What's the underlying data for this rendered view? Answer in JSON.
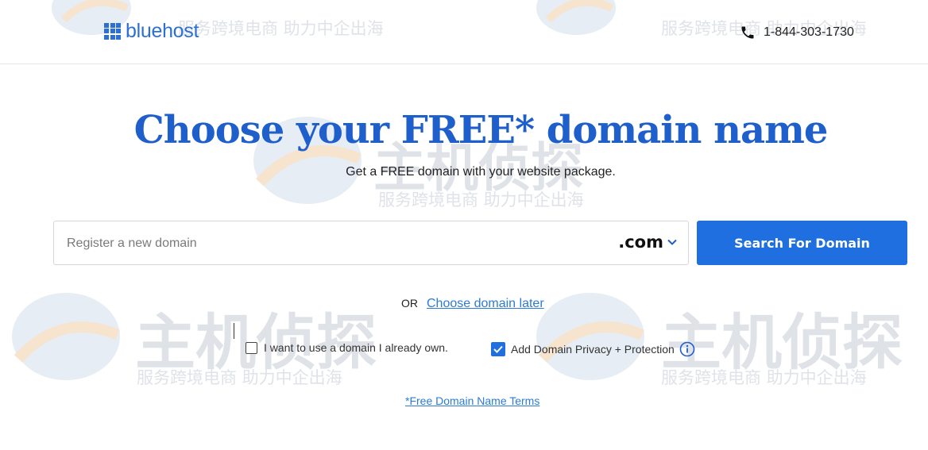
{
  "header": {
    "logo_text": "bluehost",
    "phone_icon": "phone-icon",
    "phone_number": "1-844-303-1730"
  },
  "hero": {
    "title": "Choose your FREE* domain name",
    "subtitle": "Get a FREE domain with your website package."
  },
  "search": {
    "placeholder": "Register a new domain",
    "value": "",
    "tld": ".com",
    "tld_icon": "chevron-down-icon",
    "button_label": "Search For Domain"
  },
  "alternative": {
    "or_text": "OR",
    "choose_later_label": "Choose domain later"
  },
  "options": {
    "own_domain": {
      "label": "I want to use a domain I already own.",
      "checked": false
    },
    "privacy": {
      "label": "Add Domain Privacy + Protection",
      "checked": true,
      "info_icon": "info-icon"
    }
  },
  "terms_link": "*Free Domain Name Terms",
  "watermark": {
    "logo_text": "主机侦探",
    "tagline": "服务跨境电商 助力中企出海"
  },
  "colors": {
    "brand_blue": "#1f6fe0",
    "title_blue": "#1f5fcc",
    "link_blue": "#2d7bd6"
  }
}
